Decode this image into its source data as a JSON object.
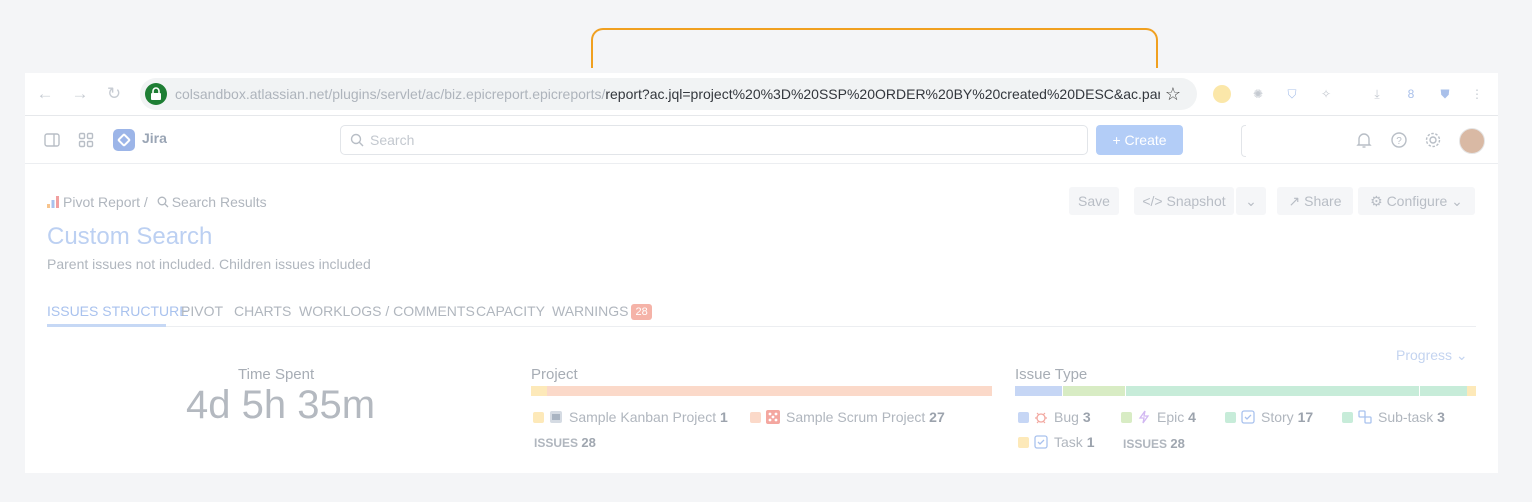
{
  "browser": {
    "url_host": "colsandbox.atlassian.net/plugins/servlet/ac/biz.epicreport.epicreports/",
    "url_path": "report?ac.jql=project%20%3D%20SSP%20ORDER%20BY%20created%20DESC&ac.parents=0..."
  },
  "jira": {
    "app_name": "Jira",
    "search_placeholder": "Search",
    "create_label": "Create"
  },
  "page": {
    "breadcrumb_root": "Pivot Report /",
    "breadcrumb_current": "Search Results",
    "title": "Custom Search",
    "subtitle": "Parent issues not included. Children issues included",
    "save_label": "Save",
    "snapshot_label": "Snapshot",
    "share_label": "Share",
    "configure_label": "Configure"
  },
  "tabs": [
    {
      "label": "ISSUES STRUCTURE",
      "active": true
    },
    {
      "label": "PIVOT"
    },
    {
      "label": "CHARTS"
    },
    {
      "label": "WORKLOGS / COMMENTS"
    },
    {
      "label": "CAPACITY"
    },
    {
      "label": "WARNINGS",
      "badge": "28"
    }
  ],
  "summary": {
    "progress_label": "Progress",
    "time_spent_label": "Time Spent",
    "time_spent_value": "4d 5h 35m",
    "project": {
      "title": "Project",
      "items": [
        {
          "name": "Sample Kanban Project",
          "count": "1",
          "color": "#fde9b9"
        },
        {
          "name": "Sample Scrum Project",
          "count": "27",
          "color": "#fbd9c9"
        }
      ],
      "issues_label": "ISSUES",
      "issues_total": "28"
    },
    "issue_type": {
      "title": "Issue Type",
      "items": [
        {
          "name": "Bug",
          "count": "3",
          "color": "#c6d6f5"
        },
        {
          "name": "Epic",
          "count": "4",
          "color": "#d8ecc4"
        },
        {
          "name": "Story",
          "count": "17",
          "color": "#c7ecd9"
        },
        {
          "name": "Sub-task",
          "count": "3",
          "color": "#c7ecd9"
        },
        {
          "name": "Task",
          "count": "1",
          "color": "#fde9b9"
        }
      ],
      "issues_label": "ISSUES",
      "issues_total": "28"
    }
  }
}
